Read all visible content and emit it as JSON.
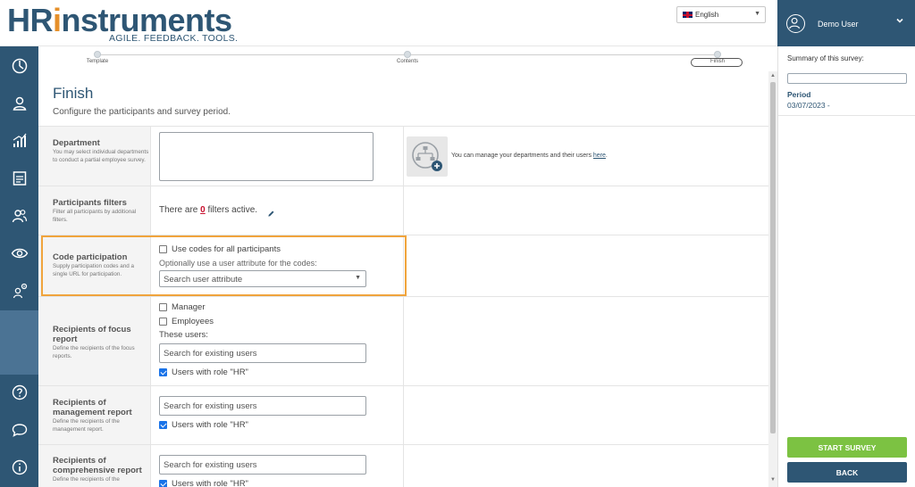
{
  "header": {
    "logo_hr": "HR",
    "logo_i": "i",
    "logo_rest": "nstruments",
    "tagline": "AGILE. FEEDBACK. TOOLS.",
    "language": "English"
  },
  "user": {
    "name": "Demo User"
  },
  "stepper": {
    "steps": [
      {
        "label": "Template"
      },
      {
        "label": "Contents"
      },
      {
        "label": "Finish"
      }
    ],
    "active": "Finish"
  },
  "page": {
    "title": "Finish",
    "subtitle": "Configure the participants and survey period."
  },
  "department": {
    "title": "Department",
    "desc": "You may select individual departments to conduct a partial employee survey.",
    "manage_text": "You can manage your departments and their users",
    "manage_link": "here",
    "manage_suffix": "."
  },
  "filters": {
    "title": "Participants filters",
    "desc": "Filter all participants by additional filters.",
    "text_before": "There are",
    "count": "0",
    "text_after": "filters active."
  },
  "code": {
    "title": "Code participation",
    "desc": "Supply participation codes and a single URL for participation.",
    "checkbox_label": "Use codes for all participants",
    "hint": "Optionally use a user attribute for the codes:",
    "select_placeholder": "Search user attribute"
  },
  "focus_report": {
    "title": "Recipients of focus report",
    "desc": "Define the recipients of the focus reports.",
    "manager_label": "Manager",
    "employees_label": "Employees",
    "these_users": "These users:",
    "search_placeholder": "Search for existing users",
    "hr_label": "Users with role \"HR\""
  },
  "management_report": {
    "title": "Recipients of management report",
    "desc": "Define the recipients of the management report.",
    "search_placeholder": "Search for existing users",
    "hr_label": "Users with role \"HR\""
  },
  "comprehensive_report": {
    "title": "Recipients of comprehensive report",
    "desc": "Define the recipients of the",
    "search_placeholder": "Search for existing users",
    "hr_label": "Users with role \"HR\""
  },
  "right_panel": {
    "summary_label": "Summary of this survey:",
    "period_label": "Period",
    "period_value": "03/07/2023 -",
    "start_button": "START SURVEY",
    "back_button": "BACK"
  },
  "colors": {
    "primary": "#2e5674",
    "accent": "#e6902a",
    "highlight": "#f0a43c",
    "start_green": "#7cc242"
  },
  "icons": [
    "dashboard-icon",
    "user-icon",
    "stats-icon",
    "survey-icon",
    "people-icon",
    "eye-icon",
    "settings-user-icon",
    "help-icon",
    "chat-icon",
    "info-icon",
    "department-tree-icon",
    "edit-pencil-icon",
    "chevron-down-icon"
  ]
}
